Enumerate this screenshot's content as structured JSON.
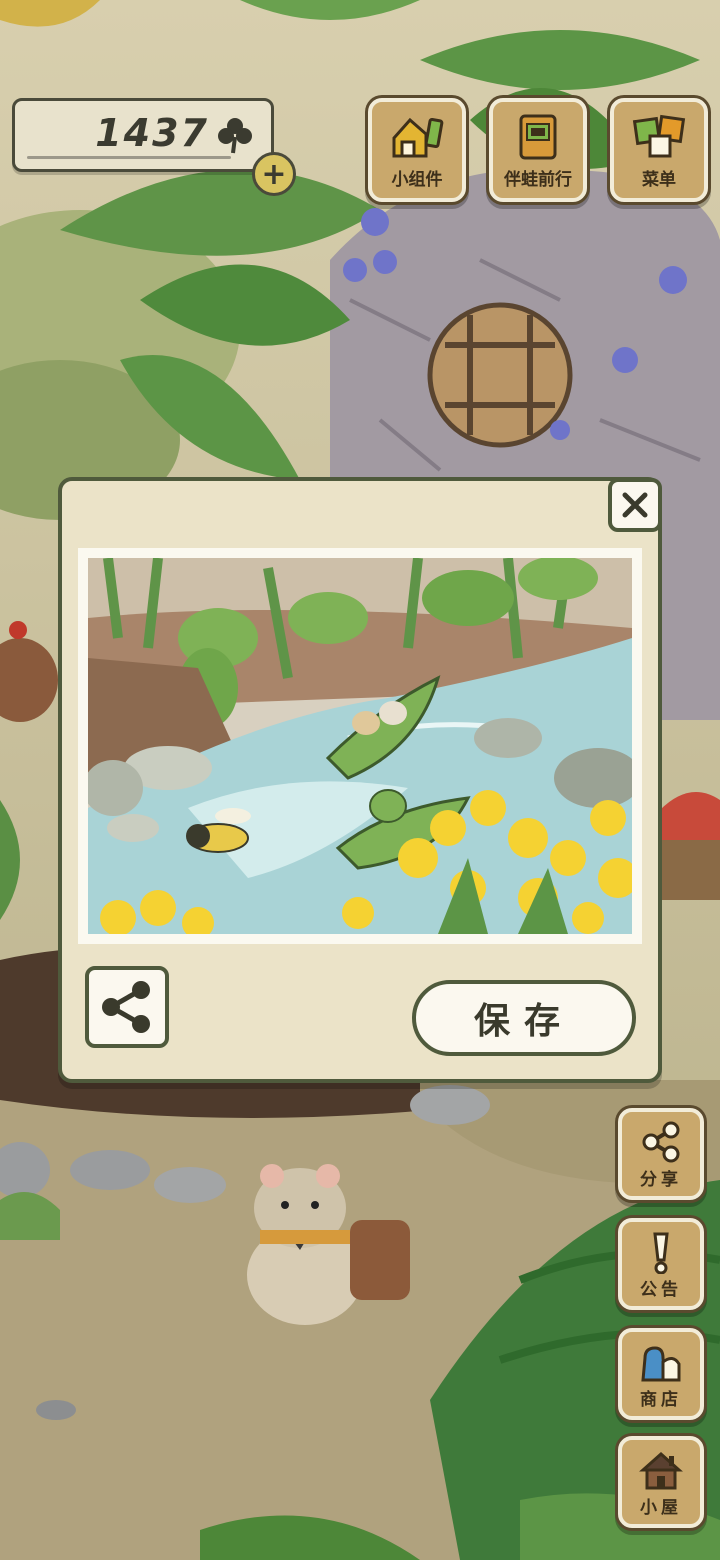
{
  "currency": {
    "amount": "1437",
    "icon": "clover-icon",
    "add_icon": "plus-icon"
  },
  "top_buttons": [
    {
      "label": "小组件",
      "icon": "widget-icon"
    },
    {
      "label": "伴蛙前行",
      "icon": "journey-book-icon"
    },
    {
      "label": "菜单",
      "icon": "menu-icon"
    }
  ],
  "side_buttons": [
    {
      "label": "分享",
      "icon": "share-icon"
    },
    {
      "label": "公告",
      "icon": "exclamation-icon"
    },
    {
      "label": "商店",
      "icon": "shop-bag-icon"
    },
    {
      "label": "小屋",
      "icon": "house-icon"
    }
  ],
  "photo_dialog": {
    "close_icon": "close-icon",
    "share_icon": "share-icon",
    "save_label": "保存"
  },
  "colors": {
    "panel_bg": "#ebe3c8",
    "panel_border": "#4f5a3c",
    "wood": "#c9a86c",
    "coin_yellow": "#d9c461"
  }
}
